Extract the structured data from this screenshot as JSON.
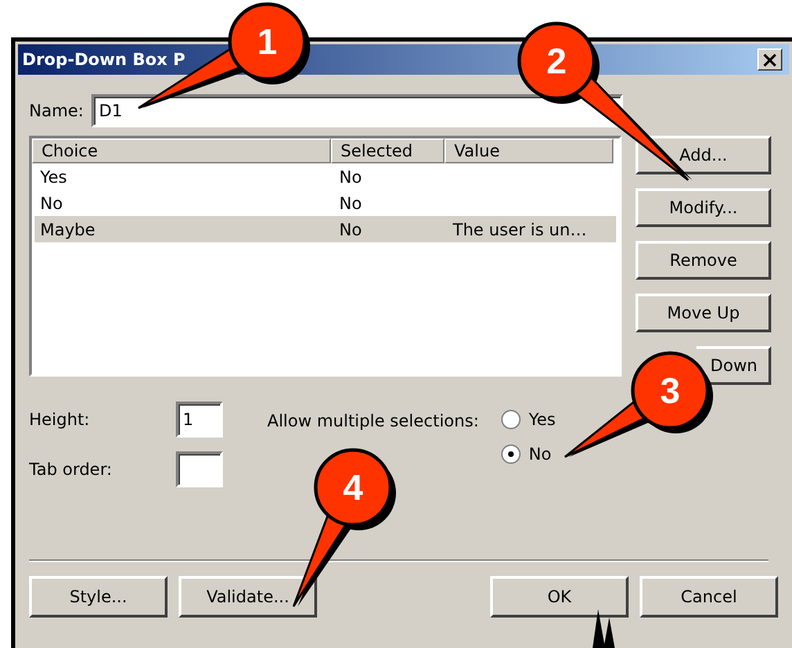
{
  "window": {
    "title": "Drop-Down Box P"
  },
  "name_field": {
    "label": "Name:",
    "value": "D1"
  },
  "table": {
    "columns": [
      "Choice",
      "Selected",
      "Value"
    ],
    "rows": [
      {
        "choice": "Yes",
        "selected_value": "No",
        "value": "",
        "selected": false
      },
      {
        "choice": "No",
        "selected_value": "No",
        "value": "",
        "selected": false
      },
      {
        "choice": "Maybe",
        "selected_value": "No",
        "value": "The user is un…",
        "selected": true
      }
    ]
  },
  "side_buttons": [
    "Add...",
    "Modify...",
    "Remove",
    "Move Up",
    "Down"
  ],
  "height_field": {
    "label": "Height:",
    "value": "1"
  },
  "tab_order_field": {
    "label": "Tab order:"
  },
  "multiple": {
    "label": "Allow multiple selections:",
    "options": [
      {
        "label": "Yes",
        "selected": false
      },
      {
        "label": "No",
        "selected": true
      }
    ]
  },
  "bottom_buttons": [
    "Style...",
    "Validate...",
    "OK",
    "Cancel"
  ],
  "callouts": [
    {
      "kind": "balloon",
      "number": "1"
    },
    {
      "kind": "balloon",
      "number": "2"
    },
    {
      "kind": "balloon",
      "number": "3"
    },
    {
      "kind": "balloon",
      "number": "4"
    },
    {
      "kind": "tail"
    }
  ]
}
